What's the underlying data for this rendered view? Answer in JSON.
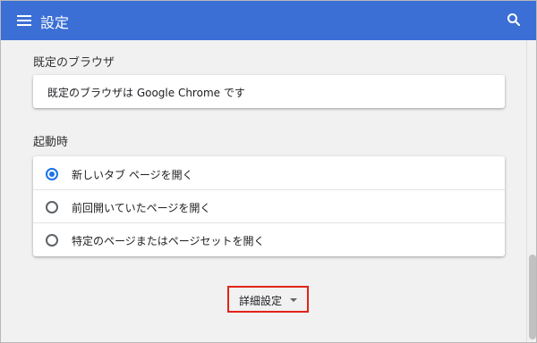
{
  "header": {
    "title": "設定",
    "menu_icon": "hamburger-menu-icon",
    "search_icon": "search-icon",
    "color": "#3b6fd6"
  },
  "default_browser": {
    "section_title": "既定のブラウザ",
    "status_text": "既定のブラウザは Google Chrome です"
  },
  "startup": {
    "section_title": "起動時",
    "options": [
      {
        "label": "新しいタブ ページを開く",
        "selected": true
      },
      {
        "label": "前回開いていたページを開く",
        "selected": false
      },
      {
        "label": "特定のページまたはページセットを開く",
        "selected": false
      }
    ],
    "accent_color": "#1a73e8"
  },
  "advanced": {
    "label": "詳細設定",
    "icon": "caret-down-icon",
    "highlight_color": "#e2231a"
  }
}
